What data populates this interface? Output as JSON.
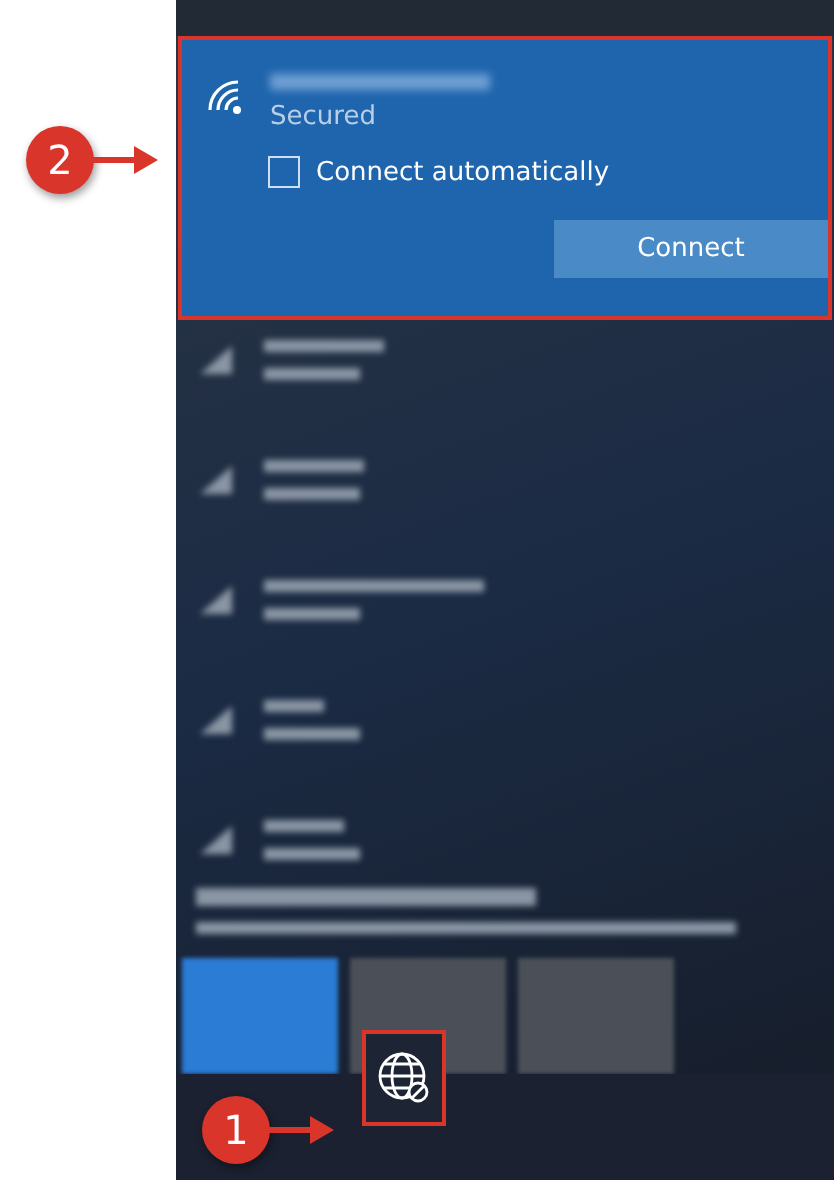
{
  "annotations": [
    {
      "label": "2"
    },
    {
      "label": "1"
    }
  ],
  "selected_network": {
    "status": "Secured",
    "connect_automatically": {
      "label": "Connect automatically",
      "checked": false
    },
    "connect_button": "Connect"
  }
}
